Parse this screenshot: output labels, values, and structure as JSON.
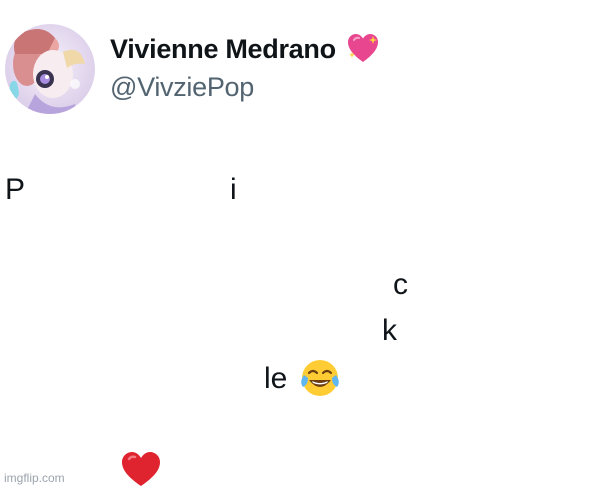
{
  "profile": {
    "display_name": "Vivienne Medrano",
    "handle": "@VivziePop",
    "name_badge_icon": "sparkling-heart-icon"
  },
  "tweet": {
    "fragments": [
      "P",
      "i",
      "c",
      "k",
      "le"
    ],
    "emoji_laugh": "face-with-tears-of-joy-icon",
    "emoji_heart": "red-heart-icon"
  },
  "watermark": "imgflip.com",
  "colors": {
    "text": "#0f1419",
    "handle": "#536471",
    "background": "#ffffff",
    "heart_pink": "#e8478f",
    "heart_red": "#e0242f"
  }
}
